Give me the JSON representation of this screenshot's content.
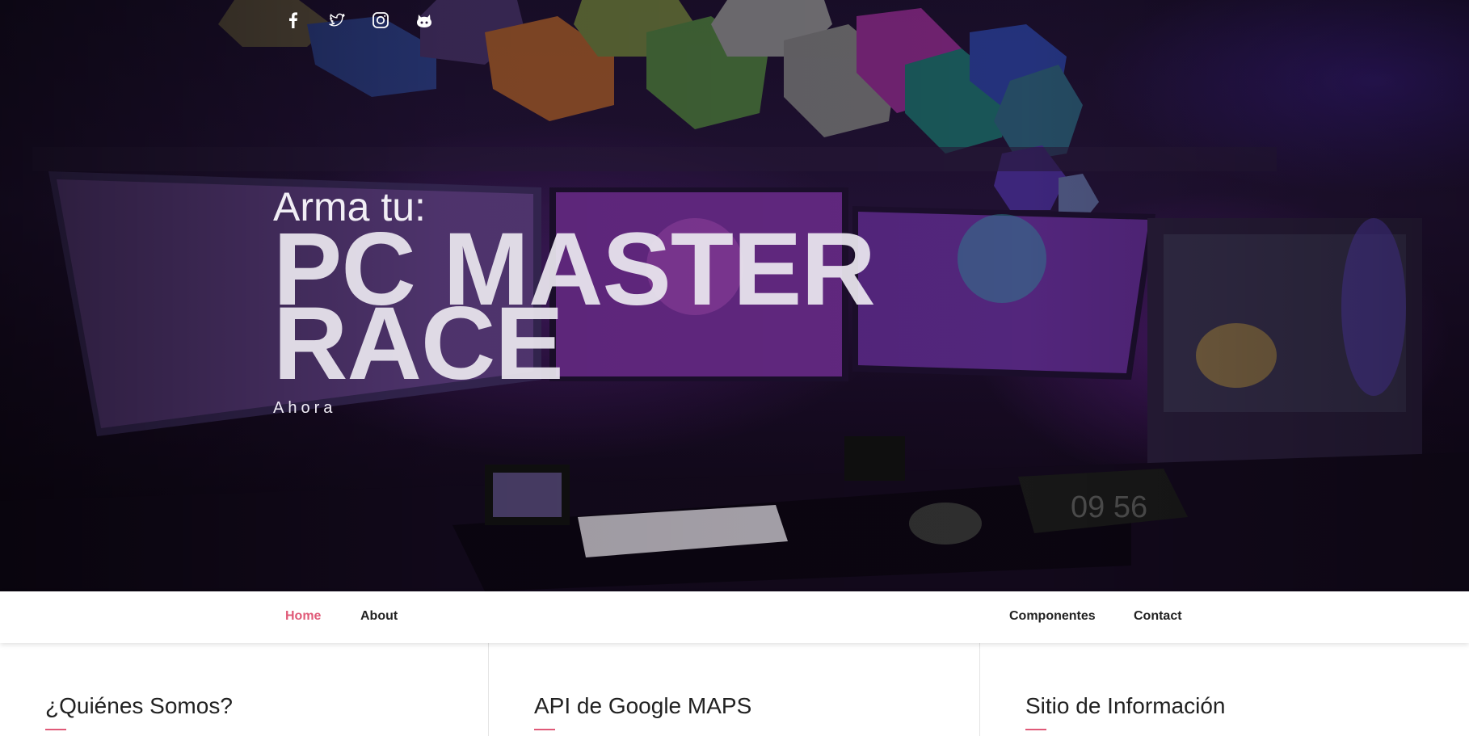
{
  "social": [
    {
      "name": "facebook-icon"
    },
    {
      "name": "twitter-icon"
    },
    {
      "name": "instagram-icon"
    },
    {
      "name": "github-icon"
    }
  ],
  "hero": {
    "subtitle": "Arma tu:",
    "title_line1": "PC MASTER",
    "title_line2": "RACE",
    "tagline": "Ahora"
  },
  "nav": {
    "left": [
      {
        "label": "Home",
        "active": true
      },
      {
        "label": "About",
        "active": false
      }
    ],
    "right": [
      {
        "label": "Componentes"
      },
      {
        "label": "Contact"
      }
    ]
  },
  "sections": [
    {
      "title": "¿Quiénes Somos?"
    },
    {
      "title": "API de Google MAPS"
    },
    {
      "title": "Sitio de Información"
    }
  ],
  "colors": {
    "accent": "#e05a78",
    "nav_text": "#222222"
  }
}
